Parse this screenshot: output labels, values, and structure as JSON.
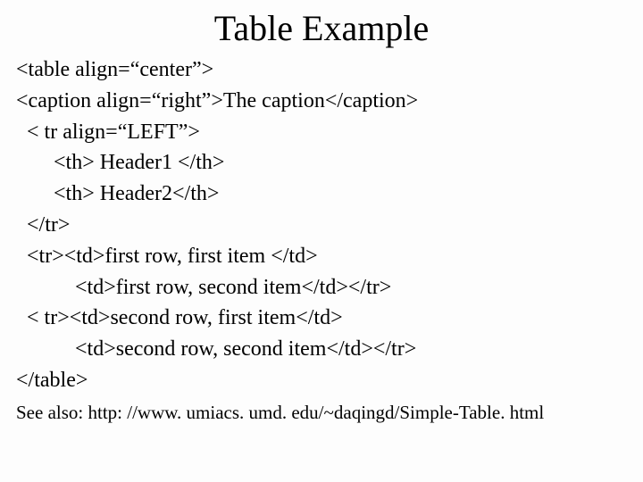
{
  "title": "Table Example",
  "code": {
    "l1": "<table align=“center”>",
    "l2": "<caption align=“right”>The caption</caption>",
    "l3": "  < tr align=“LEFT”>",
    "l4": "       <th> Header1 </th>",
    "l5": "       <th> Header2</th>",
    "l6": "  </tr>",
    "l7": "  <tr><td>first row, first item </td>",
    "l8": "           <td>first row, second item</td></tr>",
    "l9": "  < tr><td>second row, first item</td>",
    "l10": "           <td>second row, second item</td></tr>",
    "l11": "</table>"
  },
  "footnote": "See also: http: //www. umiacs. umd. edu/~daqingd/Simple-Table. html"
}
